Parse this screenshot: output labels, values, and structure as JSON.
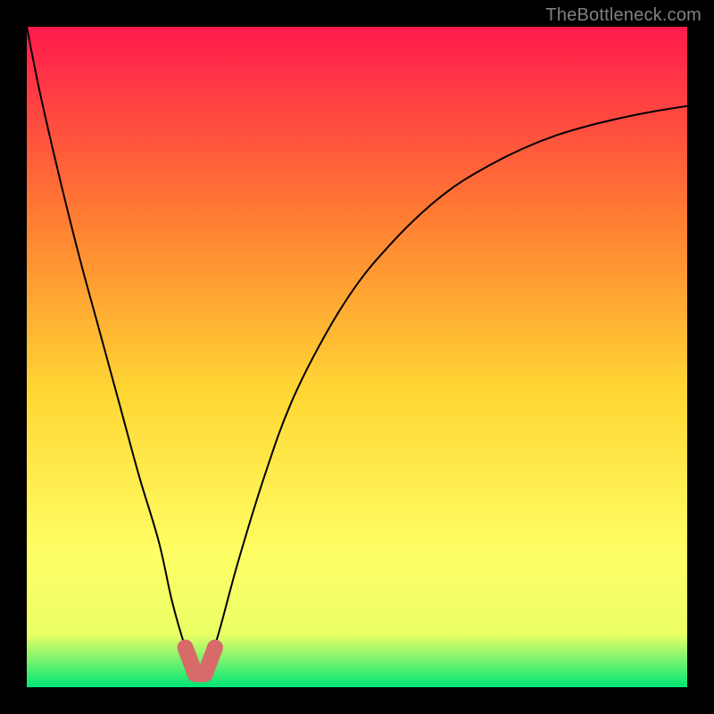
{
  "watermark": "TheBottleneck.com",
  "chart_data": {
    "type": "line",
    "title": "",
    "xlabel": "",
    "ylabel": "",
    "xlim": [
      0,
      100
    ],
    "ylim": [
      0,
      100
    ],
    "grid": false,
    "legend": false,
    "background_gradient": {
      "top": "#ff1a4d",
      "mid_upper": "#ff7a33",
      "mid": "#ffd633",
      "mid_lower": "#ffff66",
      "near_bottom": "#eaff66",
      "bottom": "#00e676"
    },
    "series": [
      {
        "name": "curve",
        "x": [
          0,
          2,
          5,
          8,
          11,
          14,
          17,
          20,
          22,
          24,
          25.5,
          27,
          29,
          32,
          36,
          40,
          45,
          50,
          55,
          60,
          65,
          70,
          75,
          80,
          85,
          90,
          95,
          100
        ],
        "y": [
          100,
          90,
          77,
          65,
          54,
          43,
          32,
          22,
          13,
          6,
          2,
          2,
          8,
          19,
          32,
          43,
          53,
          61,
          67,
          72,
          76,
          79,
          81.5,
          83.5,
          85,
          86.2,
          87.2,
          88
        ],
        "color": "#000000",
        "width": 2
      },
      {
        "name": "minimum-marker",
        "render": "marker",
        "x": [
          24,
          25.5,
          27,
          28.5
        ],
        "y": [
          6,
          2,
          2,
          6
        ],
        "color": "#d86a6a",
        "marker_size": 18
      }
    ]
  }
}
